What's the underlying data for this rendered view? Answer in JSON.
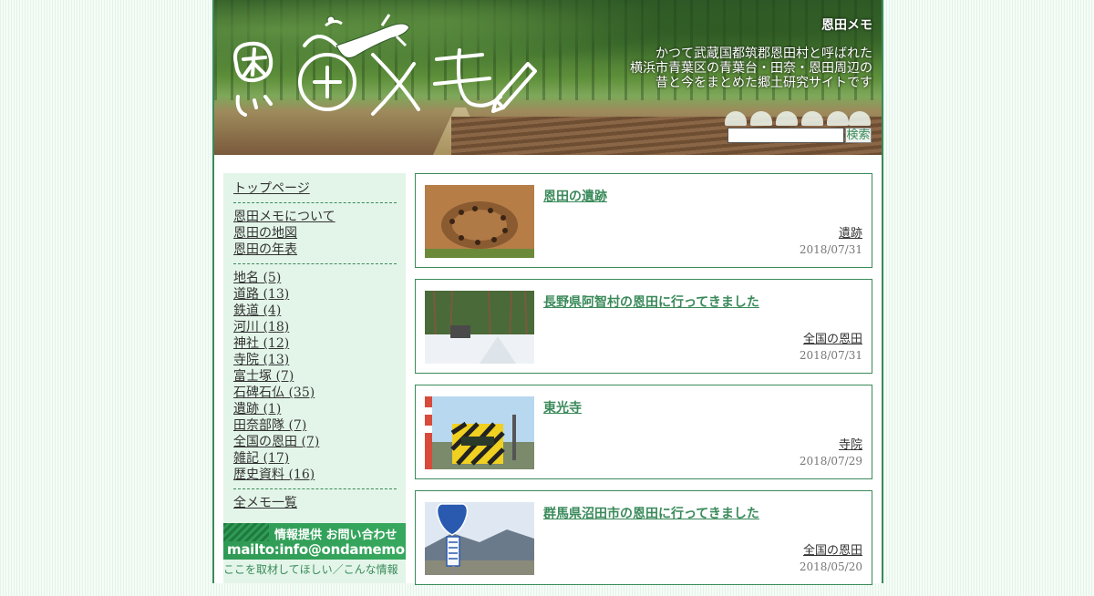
{
  "header": {
    "site_title": "恩田メモ",
    "logo_text": "恩田メモ",
    "description": [
      "かつて武蔵国都筑郡恩田村と呼ばれた",
      "横浜市青葉区の青葉台・田奈・恩田周辺の",
      "昔と今をまとめた郷土研究サイトです"
    ],
    "search_placeholder": "",
    "search_button": "検索"
  },
  "sidebar": {
    "top": "トップページ",
    "pages": [
      "恩田メモについて",
      "恩田の地図",
      "恩田の年表"
    ],
    "categories": [
      "地名 (5)",
      "道路 (13)",
      "鉄道 (4)",
      "河川 (18)",
      "神社 (12)",
      "寺院 (13)",
      "富士塚 (7)",
      "石碑石仏 (35)",
      "遺跡 (1)",
      "田奈部隊 (7)",
      "全国の恩田 (7)",
      "雑記 (17)",
      "歴史資料 (16)"
    ],
    "all_memos": "全メモ一覧",
    "banner_line1": "情報提供 お問い合わせ",
    "banner_line2": "mailto:info@ondamemo.net",
    "banner_note": "ここを取材してほしい／こんな情報"
  },
  "posts": [
    {
      "title": "恩田の遺跡",
      "category": "遺跡",
      "date": "2018/07/31",
      "thumb": "excavation-photo"
    },
    {
      "title": "長野県阿智村の恩田に行ってきました",
      "category": "全国の恩田",
      "date": "2018/07/31",
      "thumb": "snowy-road-photo"
    },
    {
      "title": "東光寺",
      "category": "寺院",
      "date": "2018/07/29",
      "thumb": "railway-crossing-photo"
    },
    {
      "title": "群馬県沼田市の恩田に行ってきました",
      "category": "全国の恩田",
      "date": "2018/05/20",
      "thumb": "route-17-sign-photo"
    }
  ],
  "colors": {
    "accent": "#3a8a5a",
    "sidebar_bg": "#e3f5e9"
  }
}
